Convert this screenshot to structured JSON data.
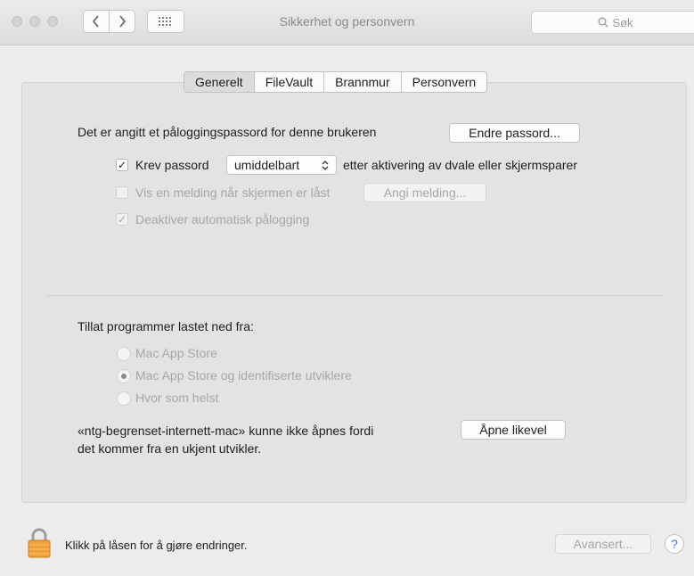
{
  "window": {
    "title": "Sikkerhet og personvern"
  },
  "toolbar": {
    "search_placeholder": "Søk",
    "back_icon": "chevron-left-icon",
    "forward_icon": "chevron-right-icon",
    "grid_icon": "grid-icon"
  },
  "tabs": [
    {
      "label": "Generelt",
      "selected": true
    },
    {
      "label": "FileVault",
      "selected": false
    },
    {
      "label": "Brannmur",
      "selected": false
    },
    {
      "label": "Personvern",
      "selected": false
    }
  ],
  "general": {
    "password_text": "Det er angitt et påloggingspassord for denne brukeren",
    "change_password_button": "Endre passord...",
    "require_password": {
      "label": "Krev passord",
      "checked": true,
      "select_value": "umiddelbart",
      "suffix": "etter aktivering av dvale eller skjermsparer"
    },
    "show_message": {
      "label": "Vis en melding når skjermen er låst",
      "checked": false,
      "button": "Angi melding..."
    },
    "disable_auto_login": {
      "label": "Deaktiver automatisk pålogging",
      "checked": true
    }
  },
  "downloads": {
    "heading": "Tillat programmer lastet ned fra:",
    "options": [
      {
        "label": "Mac App Store",
        "selected": false
      },
      {
        "label": "Mac App Store og identifiserte utviklere",
        "selected": true
      },
      {
        "label": "Hvor som helst",
        "selected": false
      }
    ],
    "blocked_line1": "«ntg-begrenset-internett-mac» kunne ikke åpnes fordi",
    "blocked_line2": "det kommer fra en ukjent utvikler.",
    "open_anyway_button": "Åpne likevel"
  },
  "footer": {
    "lock_text": "Klikk på låsen for å gjøre endringer.",
    "advanced_button": "Avansert...",
    "help_label": "?"
  },
  "colors": {
    "accent": "#3b7bd8",
    "lock": "#f2a23a"
  }
}
